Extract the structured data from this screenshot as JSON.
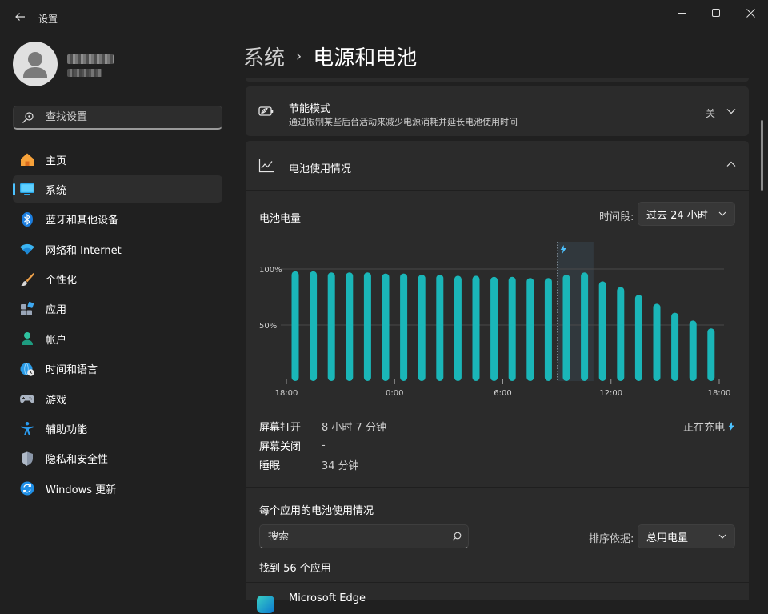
{
  "window": {
    "title": "设置"
  },
  "user": {},
  "search": {
    "placeholder": "查找设置"
  },
  "nav": {
    "items": [
      {
        "label": "主页",
        "icon": "home-icon"
      },
      {
        "label": "系统",
        "icon": "system-display-icon",
        "active": true
      },
      {
        "label": "蓝牙和其他设备",
        "icon": "bluetooth-icon"
      },
      {
        "label": "网络和 Internet",
        "icon": "wifi-icon"
      },
      {
        "label": "个性化",
        "icon": "brush-icon"
      },
      {
        "label": "应用",
        "icon": "apps-icon"
      },
      {
        "label": "帐户",
        "icon": "account-icon"
      },
      {
        "label": "时间和语言",
        "icon": "globe-clock-icon"
      },
      {
        "label": "游戏",
        "icon": "gamepad-icon"
      },
      {
        "label": "辅助功能",
        "icon": "accessibility-icon"
      },
      {
        "label": "隐私和安全性",
        "icon": "shield-icon"
      },
      {
        "label": "Windows 更新",
        "icon": "update-icon"
      }
    ]
  },
  "header": {
    "parent": "系统",
    "separator": "›",
    "current": "电源和电池"
  },
  "energy_saver": {
    "title": "节能模式",
    "description": "通过限制某些后台活动来减少电源消耗并延长电池使用时间",
    "state": "关"
  },
  "battery_usage": {
    "title": "电池使用情况",
    "level_label": "电池电量",
    "range_label": "时间段:",
    "range_value": "过去 24 小时",
    "stats": [
      {
        "label": "屏幕打开",
        "value": "8 小时 7 分钟"
      },
      {
        "label": "屏幕关闭",
        "value": "-"
      },
      {
        "label": "睡眠",
        "value": "34 分钟"
      }
    ],
    "charging_label": "正在充电"
  },
  "app_usage": {
    "title": "每个应用的电池使用情况",
    "search_placeholder": "搜索",
    "sort_label": "排序依据:",
    "sort_value": "总用电量",
    "found": "找到 56 个应用",
    "first_app": "Microsoft Edge"
  },
  "chart_data": {
    "type": "bar",
    "values": [
      98,
      98,
      97,
      97,
      97,
      96,
      96,
      95,
      95,
      94,
      94,
      93,
      93,
      92,
      92,
      95,
      97,
      89,
      84,
      77,
      69,
      61,
      54,
      47
    ],
    "x_tick_labels": [
      "18:00",
      "0:00",
      "6:00",
      "12:00",
      "18:00"
    ],
    "y_tick_labels": [
      "100%",
      "50%"
    ],
    "ylim": [
      0,
      100
    ],
    "grid": true,
    "charging_marker_after_bar": 15,
    "bar_color": "#1ab6b8"
  },
  "colors": {
    "accent": "#4cc2ff",
    "bar": "#1ab6b8",
    "background": "#202020",
    "card": "#2b2b2b"
  }
}
